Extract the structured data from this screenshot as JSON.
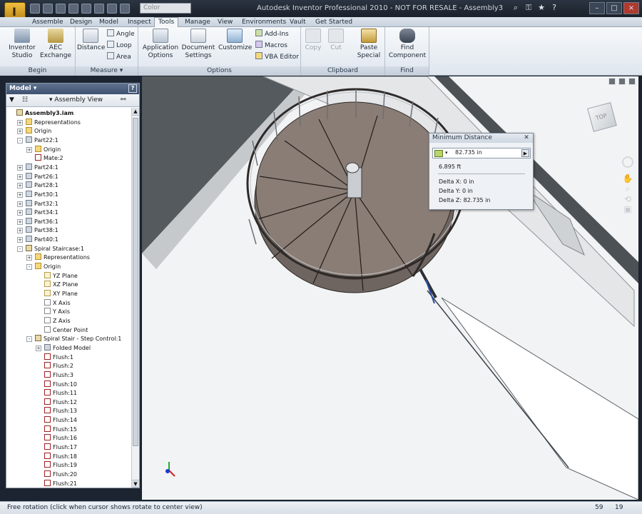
{
  "app": {
    "title": "Autodesk Inventor Professional 2010 - NOT FOR RESALE - Assembly3",
    "color_combo": "Color",
    "app_button_letter": "I"
  },
  "tabs": [
    "Assemble",
    "Design",
    "Model",
    "Inspect",
    "Tools",
    "Manage",
    "View",
    "Environments",
    "Vault",
    "Get Started"
  ],
  "active_tab": "Tools",
  "ribbon": {
    "begin": {
      "title": "Begin",
      "inventor_studio": "Inventor\nStudio",
      "aec_exchange": "AEC\nExchange"
    },
    "measure": {
      "title": "Measure",
      "distance": "Distance",
      "angle": "Angle",
      "loop": "Loop",
      "area": "Area"
    },
    "options": {
      "title": "Options",
      "application_options": "Application\nOptions",
      "document_settings": "Document\nSettings",
      "customize": "Customize",
      "add_ins": "Add-Ins",
      "macros": "Macros",
      "vba_editor": "VBA Editor"
    },
    "clipboard": {
      "title": "Clipboard",
      "copy": "Copy",
      "cut": "Cut",
      "paste_special": "Paste\nSpecial"
    },
    "find": {
      "title": "Find",
      "find_component": "Find\nComponent"
    }
  },
  "browser": {
    "title": "Model",
    "view": "Assembly View",
    "help": "?",
    "tree": [
      {
        "label": "Assembly3.iam",
        "indent": 0,
        "icon": "assembly",
        "bold": true
      },
      {
        "label": "Representations",
        "indent": 1,
        "icon": "folder",
        "exp": "+"
      },
      {
        "label": "Origin",
        "indent": 1,
        "icon": "folder",
        "exp": "+"
      },
      {
        "label": "Part22:1",
        "indent": 1,
        "icon": "part",
        "exp": "-"
      },
      {
        "label": "Origin",
        "indent": 2,
        "icon": "folder",
        "exp": "+"
      },
      {
        "label": "Mate:2",
        "indent": 2,
        "icon": "flush"
      },
      {
        "label": "Part24:1",
        "indent": 1,
        "icon": "part",
        "exp": "+"
      },
      {
        "label": "Part26:1",
        "indent": 1,
        "icon": "part",
        "exp": "+"
      },
      {
        "label": "Part28:1",
        "indent": 1,
        "icon": "part",
        "exp": "+"
      },
      {
        "label": "Part30:1",
        "indent": 1,
        "icon": "part",
        "exp": "+"
      },
      {
        "label": "Part32:1",
        "indent": 1,
        "icon": "part",
        "exp": "+"
      },
      {
        "label": "Part34:1",
        "indent": 1,
        "icon": "part",
        "exp": "+"
      },
      {
        "label": "Part36:1",
        "indent": 1,
        "icon": "part",
        "exp": "+"
      },
      {
        "label": "Part38:1",
        "indent": 1,
        "icon": "part",
        "exp": "+"
      },
      {
        "label": "Part40:1",
        "indent": 1,
        "icon": "part",
        "exp": "+"
      },
      {
        "label": "Spiral Staircase:1",
        "indent": 1,
        "icon": "assembly",
        "exp": "-"
      },
      {
        "label": "Representations",
        "indent": 2,
        "icon": "folder",
        "exp": "+"
      },
      {
        "label": "Origin",
        "indent": 2,
        "icon": "folder",
        "exp": "-"
      },
      {
        "label": "YZ Plane",
        "indent": 3,
        "icon": "plane"
      },
      {
        "label": "XZ Plane",
        "indent": 3,
        "icon": "plane"
      },
      {
        "label": "XY Plane",
        "indent": 3,
        "icon": "plane"
      },
      {
        "label": "X Axis",
        "indent": 3,
        "icon": "axis"
      },
      {
        "label": "Y Axis",
        "indent": 3,
        "icon": "axis"
      },
      {
        "label": "Z Axis",
        "indent": 3,
        "icon": "axis"
      },
      {
        "label": "Center Point",
        "indent": 3,
        "icon": "axis"
      },
      {
        "label": "Spiral Stair - Step Control:1",
        "indent": 2,
        "icon": "assembly",
        "exp": "-"
      },
      {
        "label": "Folded Model",
        "indent": 3,
        "icon": "part",
        "exp": "+"
      },
      {
        "label": "Flush:1",
        "indent": 3,
        "icon": "flush"
      },
      {
        "label": "Flush:2",
        "indent": 3,
        "icon": "flush"
      },
      {
        "label": "Flush:3",
        "indent": 3,
        "icon": "flush"
      },
      {
        "label": "Flush:10",
        "indent": 3,
        "icon": "flush"
      },
      {
        "label": "Flush:11",
        "indent": 3,
        "icon": "flush"
      },
      {
        "label": "Flush:12",
        "indent": 3,
        "icon": "flush"
      },
      {
        "label": "Flush:13",
        "indent": 3,
        "icon": "flush"
      },
      {
        "label": "Flush:14",
        "indent": 3,
        "icon": "flush"
      },
      {
        "label": "Flush:15",
        "indent": 3,
        "icon": "flush"
      },
      {
        "label": "Flush:16",
        "indent": 3,
        "icon": "flush"
      },
      {
        "label": "Flush:17",
        "indent": 3,
        "icon": "flush"
      },
      {
        "label": "Flush:18",
        "indent": 3,
        "icon": "flush"
      },
      {
        "label": "Flush:19",
        "indent": 3,
        "icon": "flush"
      },
      {
        "label": "Flush:20",
        "indent": 3,
        "icon": "flush"
      },
      {
        "label": "Flush:21",
        "indent": 3,
        "icon": "flush"
      }
    ]
  },
  "viewcube": {
    "face": "TOP"
  },
  "min_distance": {
    "title": "Minimum Distance",
    "value": "82.735 in",
    "alt_value": "6.895 ft",
    "delta_x": "Delta X: 0 in",
    "delta_y": "Delta Y: 0 in",
    "delta_z": "Delta Z: 82.735 in"
  },
  "status": {
    "text": "Free rotation (click when cursor shows rotate to center view)",
    "num1": "59",
    "num2": "19"
  },
  "colors": {
    "accent": "#3e5170",
    "viewport_floor": "#f2f3f4",
    "viewport_bg": "#555a5e",
    "stair_treads": "#8a7d75"
  }
}
